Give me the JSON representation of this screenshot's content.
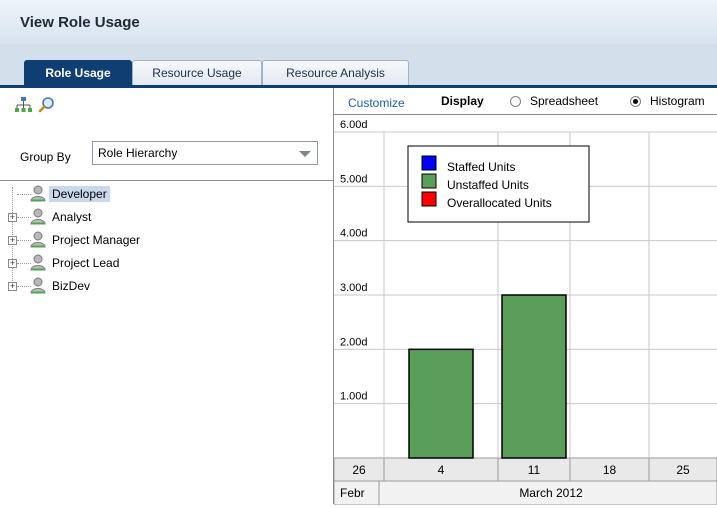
{
  "window": {
    "title": "View Role Usage"
  },
  "tabs": [
    {
      "label": "Role Usage",
      "active": true
    },
    {
      "label": "Resource Usage",
      "active": false
    },
    {
      "label": "Resource Analysis",
      "active": false
    }
  ],
  "left_panel": {
    "toolbar_icons": [
      "hierarchy-icon",
      "search-icon"
    ],
    "group_by": {
      "label": "Group By",
      "selected": "Role Hierarchy"
    },
    "tree": [
      {
        "label": "Developer",
        "expandable": false,
        "selected": true
      },
      {
        "label": "Analyst",
        "expandable": true,
        "selected": false
      },
      {
        "label": "Project Manager",
        "expandable": true,
        "selected": false
      },
      {
        "label": "Project Lead",
        "expandable": true,
        "selected": false
      },
      {
        "label": "BizDev",
        "expandable": true,
        "selected": false
      }
    ]
  },
  "right_panel": {
    "customize_label": "Customize",
    "display_label": "Display",
    "display_options": [
      {
        "label": "Spreadsheet",
        "selected": false
      },
      {
        "label": "Histogram",
        "selected": true
      }
    ]
  },
  "chart_data": {
    "type": "bar",
    "yticks": [
      "6.00d",
      "5.00d",
      "4.00d",
      "3.00d",
      "2.00d",
      "1.00d"
    ],
    "ylim": [
      0,
      6
    ],
    "week_labels": [
      "26",
      "4",
      "11",
      "18",
      "25"
    ],
    "month_labels": [
      "Febr",
      "March 2012"
    ],
    "legend": [
      {
        "name": "Staffed Units",
        "color": "#0000ff"
      },
      {
        "name": "Unstaffed Units",
        "color": "#5a9e5a"
      },
      {
        "name": "Overallocated Units",
        "color": "#ff0000"
      }
    ],
    "bars": [
      {
        "week": "26",
        "series": "Unstaffed Units",
        "value": 0
      },
      {
        "week": "4",
        "series": "Unstaffed Units",
        "value": 2
      },
      {
        "week": "11",
        "series": "Unstaffed Units",
        "value": 3
      },
      {
        "week": "18",
        "series": "Unstaffed Units",
        "value": 0
      },
      {
        "week": "25",
        "series": "Unstaffed Units",
        "value": 0
      }
    ],
    "grid": true,
    "legend_position": "top-left"
  }
}
